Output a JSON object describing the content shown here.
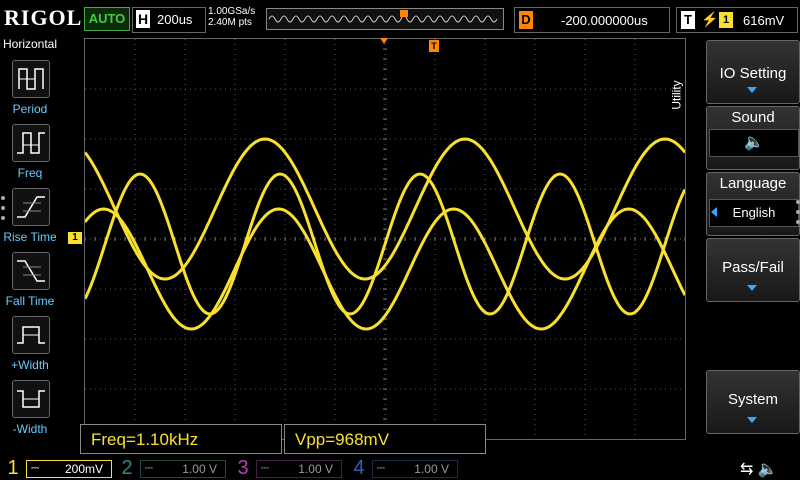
{
  "header": {
    "brand": "RIGOL",
    "run_mode": "AUTO",
    "horizontal": {
      "label": "H",
      "timebase": "200us"
    },
    "sample_rate": "1.00GSa/s",
    "mem_depth": "2.40M pts",
    "delay": {
      "label": "D",
      "value": "-200.000000us"
    },
    "trigger": {
      "label": "T",
      "source": "1",
      "level": "616mV"
    }
  },
  "left_menu": {
    "title": "Horizontal",
    "items": [
      {
        "label": "Period",
        "icon": "period-icon"
      },
      {
        "label": "Freq",
        "icon": "frequency-icon"
      },
      {
        "label": "Rise Time",
        "icon": "rise-time-icon"
      },
      {
        "label": "Fall Time",
        "icon": "fall-time-icon"
      },
      {
        "label": "+Width",
        "icon": "positive-width-icon"
      },
      {
        "label": "-Width",
        "icon": "negative-width-icon"
      }
    ]
  },
  "right_menu": {
    "title": "Utility",
    "items": [
      {
        "label": "IO Setting",
        "value": ""
      },
      {
        "label": "Sound",
        "value": ""
      },
      {
        "label": "Language",
        "value": "English"
      },
      {
        "label": "Pass/Fail",
        "value": ""
      },
      {
        "label": "System",
        "value": ""
      }
    ]
  },
  "markers": {
    "ch1_ground": "1",
    "trigger_position": "T"
  },
  "measurements": [
    {
      "text": "Freq=1.10kHz"
    },
    {
      "text": "Vpp=968mV"
    }
  ],
  "channels": [
    {
      "num": "1",
      "coupling": "DC",
      "scale": "200mV",
      "color": "#f8e030",
      "active": true
    },
    {
      "num": "2",
      "coupling": "DC",
      "scale": "1.00 V",
      "color": "#2a8a8a",
      "active": false
    },
    {
      "num": "3",
      "coupling": "DC",
      "scale": "1.00 V",
      "color": "#b040b0",
      "active": false
    },
    {
      "num": "4",
      "coupling": "DC",
      "scale": "1.00 V",
      "color": "#3060c0",
      "active": false
    }
  ],
  "colors": {
    "trace": "#f8e030",
    "accent": "#3aaaff",
    "trigger": "#ff8800"
  }
}
